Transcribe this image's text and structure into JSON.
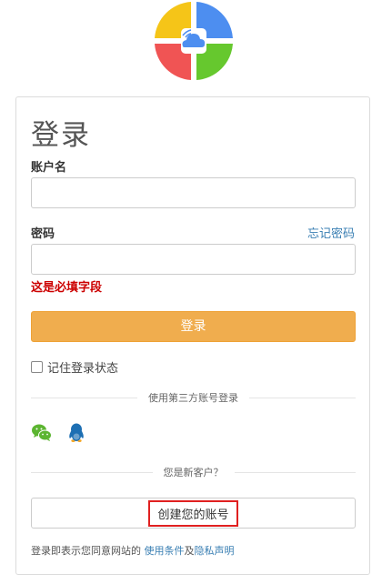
{
  "logo": {
    "icon": "cloud-wifi-logo-icon",
    "colors": [
      "#f5c518",
      "#4d8ef0",
      "#f05454",
      "#66c82e"
    ]
  },
  "form": {
    "title": "登录",
    "username_label": "账户名",
    "username_value": "",
    "password_label": "密码",
    "password_value": "",
    "forgot_password": "忘记密码",
    "error_message": "这是必填字段",
    "login_button": "登录",
    "remember_label": "记住登录状态",
    "remember_checked": false
  },
  "social": {
    "divider_text": "使用第三方账号登录",
    "providers": [
      {
        "name": "WeChat",
        "icon": "wechat-icon",
        "color": "#5cb531"
      },
      {
        "name": "QQ",
        "icon": "qq-penguin-icon",
        "color": "#1d6fb3"
      }
    ]
  },
  "register": {
    "divider_text": "您是新客户？",
    "create_button": "创建您的账号"
  },
  "footer": {
    "prefix": "登录即表示您同意网站的 ",
    "terms_link": "使用条件",
    "and_text": "及",
    "privacy_link": "隐私声明"
  },
  "colors": {
    "accent_button": "#f0ad4e",
    "link": "#3a7fb3",
    "error": "#cc0000",
    "highlight_border": "#e02020"
  }
}
